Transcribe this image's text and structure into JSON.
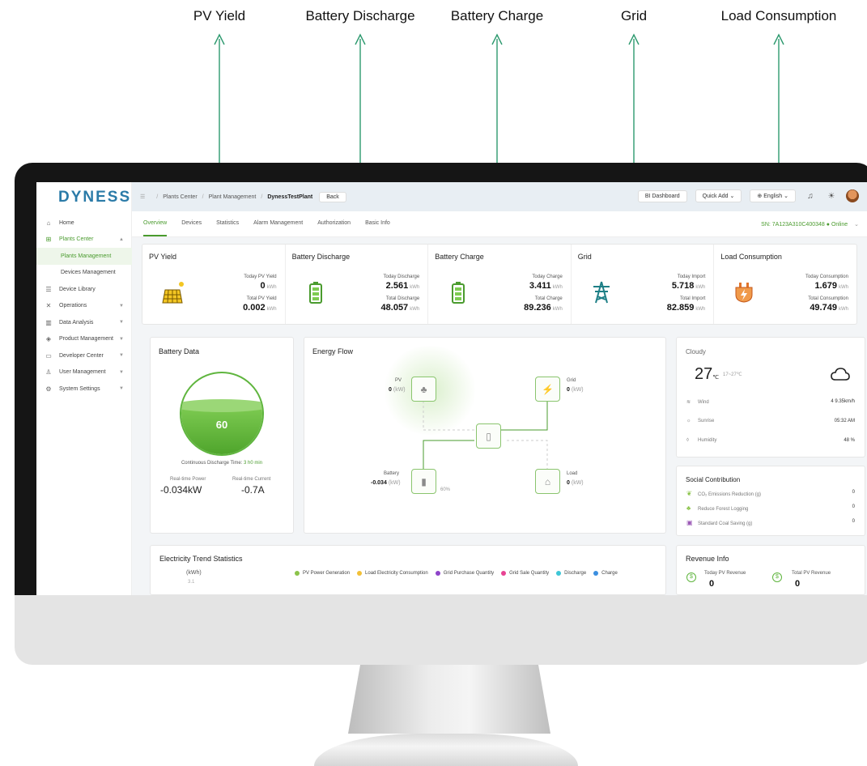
{
  "callouts": {
    "pv": "PV Yield",
    "battery_discharge": "Battery Discharge",
    "battery_charge": "Battery Charge",
    "grid": "Grid",
    "load": "Load Consumption"
  },
  "app": {
    "logo": "DYNESS"
  },
  "sidebar": {
    "items": [
      {
        "label": "Home",
        "icon": "home-icon"
      },
      {
        "label": "Plants Center",
        "icon": "plants-icon"
      },
      {
        "label": "Plants Management"
      },
      {
        "label": "Devices Management"
      },
      {
        "label": "Device Library",
        "icon": "library-icon"
      },
      {
        "label": "Operations",
        "icon": "tools-icon"
      },
      {
        "label": "Data Analysis",
        "icon": "chart-icon"
      },
      {
        "label": "Product Management",
        "icon": "product-icon"
      },
      {
        "label": "Developer Center",
        "icon": "developer-icon"
      },
      {
        "label": "User Management",
        "icon": "user-icon"
      },
      {
        "label": "System Settings",
        "icon": "settings-icon"
      }
    ]
  },
  "topbar": {
    "breadcrumb": [
      "Plants Center",
      "Plant Management",
      "DynessTestPlant"
    ],
    "back": "Back",
    "bi_dashboard": "BI Dashboard",
    "quick_add": "Quick Add",
    "language": "English"
  },
  "tabs": [
    "Overview",
    "Devices",
    "Statistics",
    "Alarm Management",
    "Authorization",
    "Basic Info"
  ],
  "status": {
    "sn": "SN: 7A123A310C400348",
    "online": "Online"
  },
  "summary": {
    "pv": {
      "title": "PV Yield",
      "l1": "Today PV Yield",
      "v1": "0",
      "l2": "Total PV Yield",
      "v2": "0.002",
      "unit": "kWh"
    },
    "discharge": {
      "title": "Battery Discharge",
      "l1": "Today Discharge",
      "v1": "2.561",
      "l2": "Total Discharge",
      "v2": "48.057",
      "unit": "kWh"
    },
    "charge": {
      "title": "Battery Charge",
      "l1": "Today Charge",
      "v1": "3.411",
      "l2": "Total Charge",
      "v2": "89.236",
      "unit": "kWh"
    },
    "grid": {
      "title": "Grid",
      "l1": "Today Import",
      "v1": "5.718",
      "l2": "Total Import",
      "v2": "82.859",
      "unit": "kWh"
    },
    "load": {
      "title": "Load Consumption",
      "l1": "Today Consumption",
      "v1": "1.679",
      "l2": "Total Consumption",
      "v2": "49.749",
      "unit": "kWh"
    }
  },
  "battery": {
    "title": "Battery Data",
    "soc": "60",
    "soc_fraction": 0.6,
    "discharge_label": "Continuous Discharge Time:",
    "discharge_time": "3 h0 min",
    "power_label": "Real-time Power",
    "power": "-0.034kW",
    "current_label": "Real-time Current",
    "current": "-0.7A"
  },
  "flow": {
    "title": "Energy Flow",
    "pv_label": "PV",
    "pv_val": "0",
    "grid_label": "Grid",
    "grid_val": "0",
    "battery_label": "Battery",
    "battery_val": "-0.034",
    "load_label": "Load",
    "load_val": "0",
    "unit": "(kW)",
    "battery_pct": "60%"
  },
  "weather": {
    "condition": "Cloudy",
    "temp": "27",
    "temp_unit": "℃",
    "range": "17~27℃",
    "wind_label": "Wind",
    "wind": "4  9.35km/h",
    "sunrise_label": "Sunrise",
    "sunrise": "05:32 AM",
    "humidity_label": "Humidity",
    "humidity": "48 %"
  },
  "social": {
    "title": "Social Contribution",
    "rows": [
      {
        "label": "CO₂ Emissions Reduction (g)",
        "value": "0"
      },
      {
        "label": "Reduce Forest Logging",
        "value": "0"
      },
      {
        "label": "Standard Coal Saving (g)",
        "value": "0"
      }
    ]
  },
  "trend": {
    "title": "Electricity Trend Statistics",
    "unit": "(kWh)",
    "y_top": "3.1",
    "legend": [
      {
        "label": "PV Power Generation",
        "color": "#8bc34a"
      },
      {
        "label": "Load Electricity Consumption",
        "color": "#f2c037"
      },
      {
        "label": "Grid Purchase Quantity",
        "color": "#8e44c9"
      },
      {
        "label": "Grid Sale Quantity",
        "color": "#e84393"
      },
      {
        "label": "Discharge",
        "color": "#3ec6d6"
      },
      {
        "label": "Charge",
        "color": "#3b8fe0"
      }
    ]
  },
  "revenue": {
    "title": "Revenue Info",
    "today_label": "Today PV Revenue",
    "total_label": "Total PV Revenue",
    "today": "0",
    "total": "0"
  },
  "colors": {
    "accent": "#4a9b2e",
    "pointer": "#2e9a6f"
  }
}
